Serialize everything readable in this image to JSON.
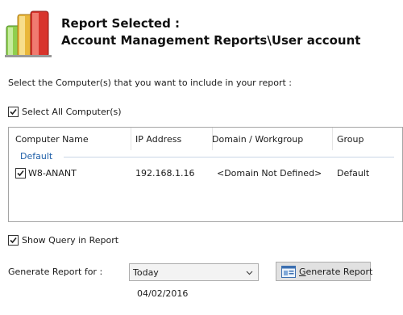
{
  "header": {
    "title_line1": "Report Selected :",
    "title_line2": "Account Management Reports\\User account"
  },
  "instruction": "Select the Computer(s) that you want to include in your report :",
  "select_all": {
    "label": "Select All Computer(s)",
    "checked": true
  },
  "table": {
    "columns": [
      "Computer Name",
      "IP Address",
      "Domain / Workgroup",
      "Group"
    ],
    "group_label": "Default",
    "rows": [
      {
        "checked": true,
        "computer": "W8-ANANT",
        "ip": "192.168.1.16",
        "domain": "<Domain Not Defined>",
        "group": "Default"
      }
    ]
  },
  "show_query": {
    "label": "Show Query in Report",
    "checked": true
  },
  "generate_for": {
    "label": "Generate Report for  :",
    "selected": "Today"
  },
  "generate_button": {
    "accel": "G",
    "rest": "enerate Report"
  },
  "date": "04/02/2016",
  "colors": {
    "group_label": "#1f5fa8",
    "list_border": "#a5a5a5"
  }
}
